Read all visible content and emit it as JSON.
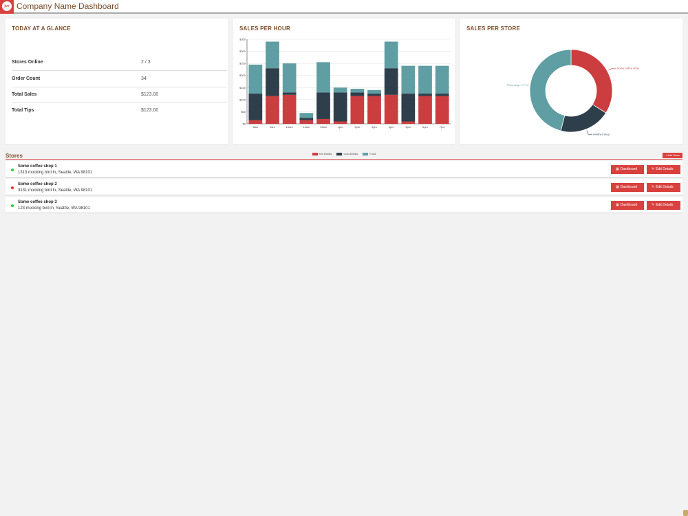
{
  "header": {
    "logo_text": "joe",
    "title": "Company Name Dashboard"
  },
  "glance": {
    "title": "TODAY AT A GLANCE",
    "rows": [
      {
        "label": "Stores Online",
        "value": "2 / 3"
      },
      {
        "label": "Order Count",
        "value": "34"
      },
      {
        "label": "Total Sales",
        "value": "$123.00"
      },
      {
        "label": "Total Tips",
        "value": "$123.00"
      }
    ]
  },
  "sales_per_hour": {
    "title": "SALES PER HOUR",
    "chart_data": {
      "type": "bar",
      "stacked": true,
      "categories": [
        "8am",
        "9am",
        "10am",
        "11am",
        "12am",
        "1pm",
        "2pm",
        "3pm",
        "4pm",
        "5pm",
        "6pm",
        "7pm"
      ],
      "series": [
        {
          "name": "Hot Drinks",
          "color": "#cc3d3f",
          "values": [
            15,
            115,
            120,
            15,
            20,
            10,
            115,
            115,
            120,
            10,
            115,
            115
          ]
        },
        {
          "name": "Cold Drinks",
          "color": "#2e3e4b",
          "values": [
            110,
            115,
            10,
            10,
            110,
            120,
            15,
            10,
            110,
            115,
            10,
            10
          ]
        },
        {
          "name": "Food",
          "color": "#5f9ea3",
          "values": [
            120,
            110,
            120,
            20,
            125,
            20,
            15,
            15,
            110,
            115,
            115,
            115
          ]
        }
      ],
      "ylim": [
        0,
        350
      ],
      "yticks": [
        "$0",
        "$50",
        "$100",
        "$150",
        "$200",
        "$250",
        "$300",
        "$350"
      ],
      "legend": "bottom",
      "grid": true
    }
  },
  "sales_per_store": {
    "title": "SALES PER STORE",
    "chart_data": {
      "type": "pie",
      "donut": true,
      "slices": [
        {
          "label": "Some coffee shop",
          "value": 34,
          "color": "#cc3d3f"
        },
        {
          "label": "Another shop",
          "value": 20,
          "color": "#2e3e4b"
        },
        {
          "label": "Third shop",
          "value": 46,
          "color": "#5f9ea3"
        }
      ]
    }
  },
  "stores": {
    "title": "Stores",
    "add_label": "+ Add Store",
    "dashboard_label": "Dashboard",
    "edit_label": "Edit Details",
    "online_color": "#2ecc40",
    "offline_color": "#e03030",
    "items": [
      {
        "name": "Some coffee shop 1",
        "address": "1313 mocking bird ln, Seattle, WA 98101",
        "online": true
      },
      {
        "name": "Some coffee shop 2",
        "address": "3131 mocking bird ln, Seattle, WA 98101",
        "online": false
      },
      {
        "name": "Some coffee shop 3",
        "address": "123 mocking bird ln, Seattle, WA 98101",
        "online": true
      }
    ]
  },
  "icons": {
    "logo": "coffee-logo-icon",
    "dashboard": "grid-icon",
    "edit": "pencil-icon",
    "status": "status-dot-icon"
  }
}
